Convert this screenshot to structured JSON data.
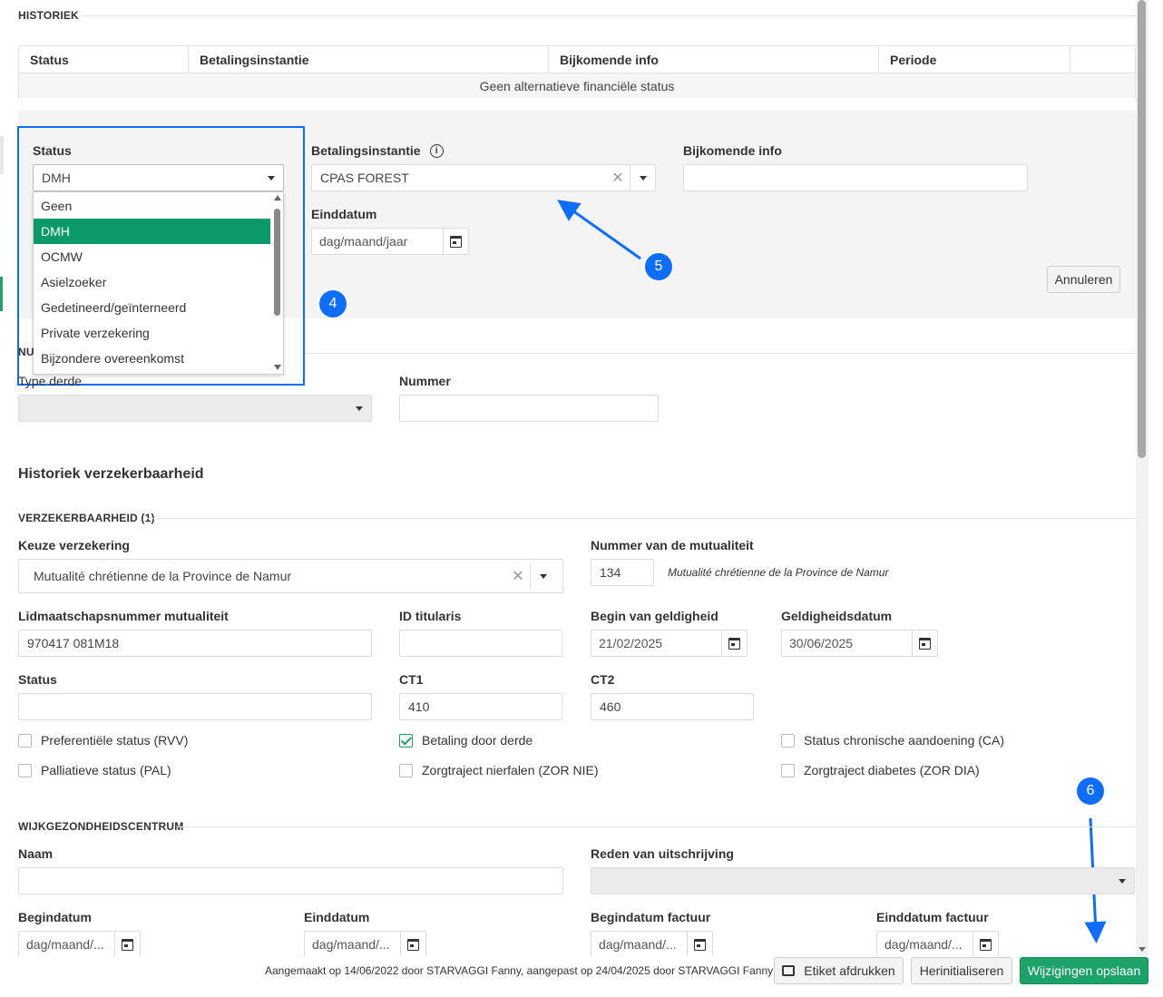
{
  "historiek": {
    "section_title": "HISTORIEK",
    "columns": [
      "Status",
      "Betalingsinstantie",
      "Bijkomende info",
      "Periode"
    ],
    "empty_text": "Geen alternatieve financiële status"
  },
  "form": {
    "status_label": "Status",
    "status_value": "DMH",
    "status_options": [
      "Geen",
      "DMH",
      "OCMW",
      "Asielzoeker",
      "Gedetineerd/geïnterneerd",
      "Private verzekering",
      "Bijzondere overeenkomst"
    ],
    "status_selected": "DMH",
    "betaling_label": "Betalingsinstantie",
    "betaling_value": "CPAS FOREST",
    "bijkomende_label": "Bijkomende info",
    "bijkomende_value": "",
    "einddatum_label": "Einddatum",
    "einddatum_placeholder": "dag/maand/jaar",
    "annuleren": "Annuleren"
  },
  "nummer_section": {
    "title_visible": "NU",
    "type_label": "Type derde",
    "nummer_label": "Nummer"
  },
  "verzekerbaarheid": {
    "heading": "Historiek verzekerbaarheid",
    "section_title": "VERZEKERBAARHEID (1)",
    "keuze_label": "Keuze verzekering",
    "keuze_value": "Mutualité chrétienne de la Province de Namur",
    "nummer_mut_label": "Nummer van de mutualiteit",
    "nummer_mut_value": "134",
    "nummer_mut_name": "Mutualité chrétienne de la Province de Namur",
    "lidmaatschap_label": "Lidmaatschapsnummer mutualiteit",
    "lidmaatschap_value": "970417 081M18",
    "titularis_label": "ID titularis",
    "begin_label": "Begin van geldigheid",
    "begin_value": "21/02/2025",
    "geldig_label": "Geldigheidsdatum",
    "geldig_value": "30/06/2025",
    "status_label": "Status",
    "ct1_label": "CT1",
    "ct1_value": "410",
    "ct2_label": "CT2",
    "ct2_value": "460",
    "checkboxes": [
      {
        "label": "Preferentiële status (RVV)",
        "checked": false
      },
      {
        "label": "Betaling door derde",
        "checked": true
      },
      {
        "label": "Status chronische aandoening (CA)",
        "checked": false
      },
      {
        "label": "Palliatieve status (PAL)",
        "checked": false
      },
      {
        "label": "Zorgtraject nierfalen (ZOR NIE)",
        "checked": false
      },
      {
        "label": "Zorgtraject diabetes (ZOR DIA)",
        "checked": false
      }
    ]
  },
  "wgc": {
    "section_title": "WIJKGEZONDHEIDSCENTRUM",
    "naam_label": "Naam",
    "reden_label": "Reden van uitschrijving",
    "begindatum_label": "Begindatum",
    "einddatum_label": "Einddatum",
    "begin_factuur_label": "Begindatum factuur",
    "eind_factuur_label": "Einddatum factuur",
    "date_placeholder": "dag/maand/..."
  },
  "footer": {
    "info": "Aangemaakt op 14/06/2022 door STARVAGGI Fanny, aangepast op 24/04/2025 door STARVAGGI Fanny",
    "print": "Etiket afdrukken",
    "reset": "Herinitialiseren",
    "save": "Wijzigingen opslaan"
  },
  "annotations": {
    "badge4": "4",
    "badge5": "5",
    "badge6": "6"
  },
  "colors": {
    "accent_green": "#1ca36a",
    "selected_option": "#0a9a6a",
    "annotation_blue": "#0d6efd"
  }
}
